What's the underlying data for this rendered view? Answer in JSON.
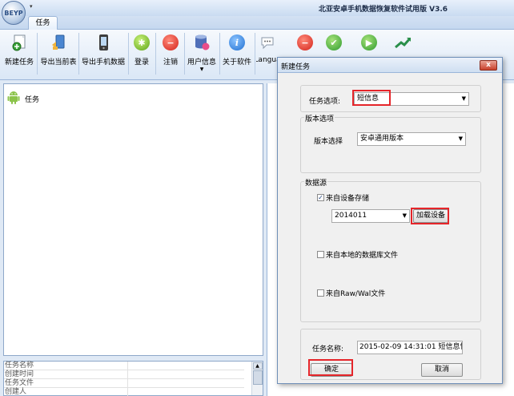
{
  "app": {
    "title": "北亚安卓手机数据恢复软件试用版 V3.6",
    "logo_text": "BEYP",
    "quick_access": "▾"
  },
  "ribbon": {
    "tab": "任务",
    "buttons": [
      {
        "label": "新建任务",
        "icon": "new-task-icon"
      },
      {
        "label": "导出当前表",
        "icon": "export-table-icon"
      },
      {
        "label": "导出手机数据",
        "icon": "phone-icon"
      },
      {
        "label": "登录",
        "icon": "login-icon"
      },
      {
        "label": "注销",
        "icon": "logout-icon"
      },
      {
        "label": "用户信息",
        "icon": "database-user-icon"
      },
      {
        "label": "关于软件",
        "icon": "info-icon"
      },
      {
        "label": "Langua",
        "icon": "language-icon"
      }
    ]
  },
  "tree": {
    "root_label": "任务"
  },
  "propgrid": {
    "rows": [
      "任务名称",
      "创建时间",
      "任务文件",
      "创建人"
    ]
  },
  "dialog": {
    "title": "新建任务",
    "close_glyph": "x",
    "task_option_label": "任务选项:",
    "task_option_value": "短信息",
    "version_group_caption": "版本选项",
    "version_label": "版本选择",
    "version_value": "安卓通用版本",
    "source_group_caption": "数据源",
    "from_device_label": "来自设备存储",
    "from_device_checked": true,
    "device_value": "2014011",
    "load_device_button": "加载设备",
    "from_db_label": "来自本地的数据库文件",
    "from_raw_label": "来自Raw/Wal文件",
    "task_name_label": "任务名称:",
    "task_name_value": "2015-02-09 14:31:01 短信息恢复",
    "ok_button": "确定",
    "cancel_button": "取消"
  },
  "colors": {
    "highlight": "#e5252a",
    "ribbon_border": "#9bb6d9"
  }
}
